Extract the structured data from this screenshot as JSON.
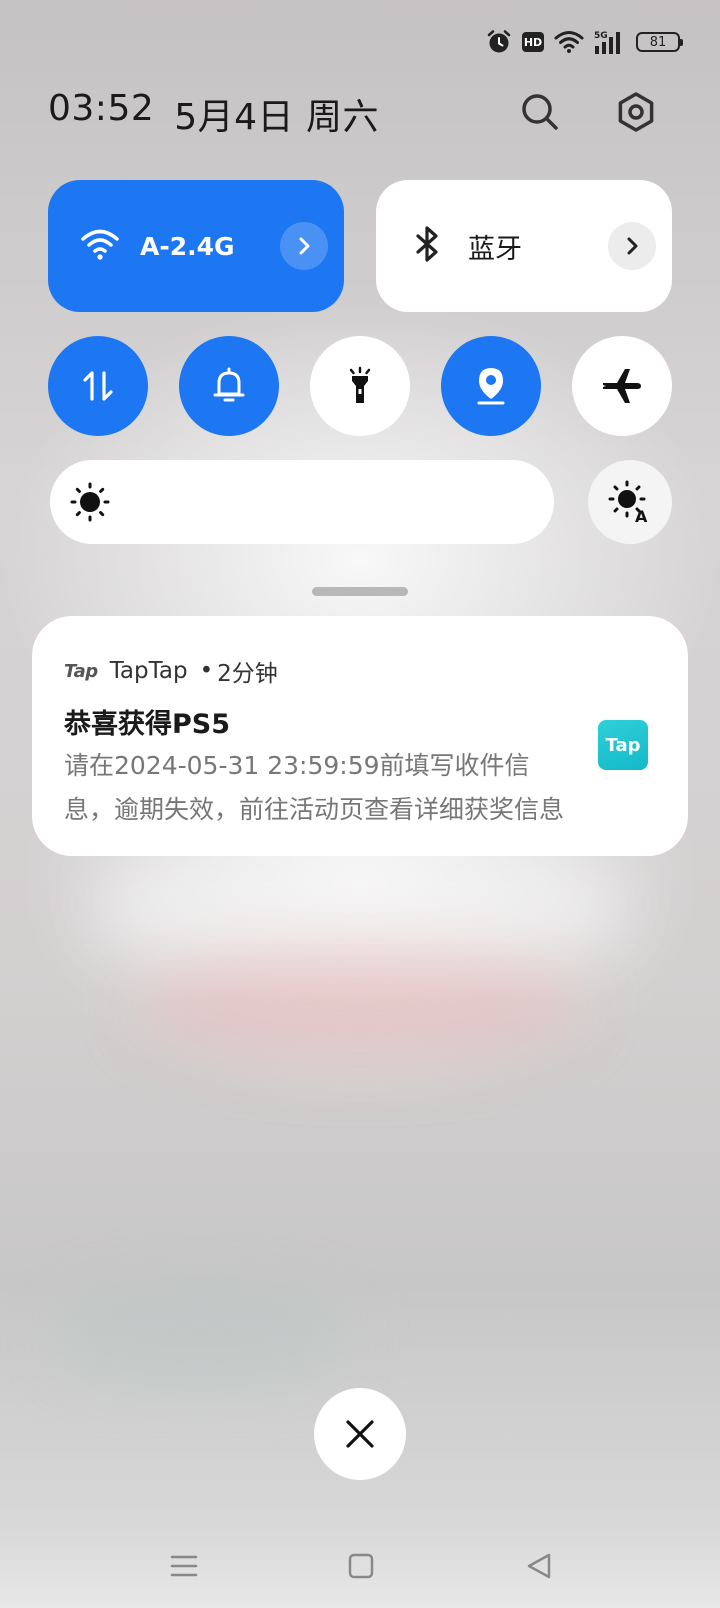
{
  "status_bar": {
    "icons": [
      "alarm-icon",
      "hd-icon",
      "wifi-icon",
      "signal-5g-icon"
    ],
    "hd_label": "HD",
    "network_label": "5G",
    "battery_level": "81"
  },
  "header": {
    "time": "03:52",
    "date": "5月4日 周六",
    "search_icon": "search-icon",
    "settings_icon": "settings-icon"
  },
  "tiles": {
    "wifi": {
      "label": "A-2.4G",
      "active": true,
      "icon": "wifi-icon"
    },
    "bluetooth": {
      "label": "蓝牙",
      "active": false,
      "icon": "bluetooth-icon"
    }
  },
  "toggles": [
    {
      "name": "mobile-data",
      "icon": "data-arrows-icon",
      "active": true
    },
    {
      "name": "ringer",
      "icon": "bell-icon",
      "active": true
    },
    {
      "name": "flashlight",
      "icon": "flashlight-icon",
      "active": false
    },
    {
      "name": "location",
      "icon": "location-icon",
      "active": true
    },
    {
      "name": "airplane-mode",
      "icon": "airplane-icon",
      "active": false
    }
  ],
  "brightness": {
    "icon": "sun-icon",
    "auto_icon": "auto-brightness-icon",
    "auto_label": "A"
  },
  "notification": {
    "app_logo_text": "Tap",
    "app_name": "TapTap",
    "separator": "•",
    "time_ago": "2分钟",
    "title": "恭喜获得PS5",
    "body": "请在2024-05-31 23:59:59前填写收件信息，逾期失效，前往活动页查看详细获奖信息",
    "app_icon_text": "Tap",
    "colors": {
      "app_icon": "#1cc2d0"
    }
  },
  "colors": {
    "accent": "#1d76f2",
    "tile_off": "#ffffff",
    "text_primary": "#1a1a1a",
    "text_secondary": "#777777"
  }
}
